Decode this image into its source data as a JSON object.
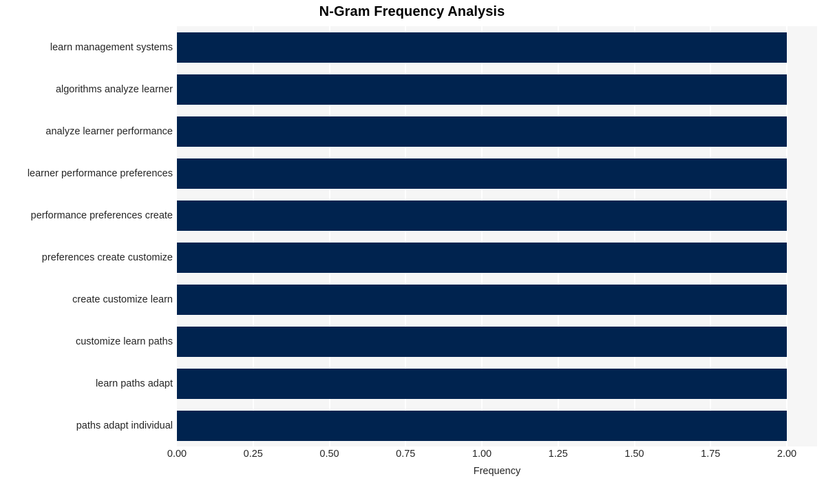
{
  "chart_data": {
    "type": "bar",
    "orientation": "horizontal",
    "title": "N-Gram Frequency Analysis",
    "xlabel": "Frequency",
    "ylabel": "",
    "categories": [
      "learn management systems",
      "algorithms analyze learner",
      "analyze learner performance",
      "learner performance preferences",
      "performance preferences create",
      "preferences create customize",
      "create customize learn",
      "customize learn paths",
      "learn paths adapt",
      "paths adapt individual"
    ],
    "values": [
      2,
      2,
      2,
      2,
      2,
      2,
      2,
      2,
      2,
      2
    ],
    "xlim": [
      0,
      2.0
    ],
    "x_ticks": [
      0,
      0.25,
      0.5,
      0.75,
      1.0,
      1.25,
      1.5,
      1.75,
      2.0
    ],
    "x_tick_labels": [
      "0.00",
      "0.25",
      "0.50",
      "0.75",
      "1.00",
      "1.25",
      "1.50",
      "1.75",
      "2.00"
    ],
    "grid": true,
    "grid_axis": "x",
    "legend": null,
    "bar_color": "#00234f",
    "plot_background": "#f6f6f6",
    "grid_color": "#ffffff",
    "figure_background": "#ffffff",
    "text_color": "#262626"
  }
}
